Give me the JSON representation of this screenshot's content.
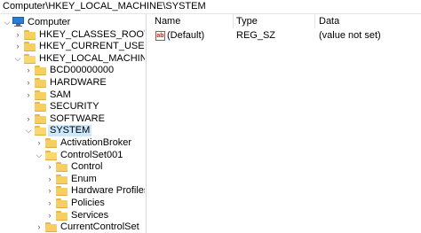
{
  "address": {
    "path": "Computer\\HKEY_LOCAL_MACHINE\\SYSTEM"
  },
  "tree": {
    "items": [
      {
        "label": "Computer",
        "icon": "computer-icon",
        "chevron": "v"
      },
      {
        "label": "HKEY_CLASSES_ROOT",
        "icon": "folder-icon",
        "chevron": ">"
      },
      {
        "label": "HKEY_CURRENT_USER",
        "icon": "folder-icon",
        "chevron": ">"
      },
      {
        "label": "HKEY_LOCAL_MACHINE",
        "icon": "folder-open-icon",
        "chevron": "v"
      },
      {
        "label": "BCD00000000",
        "icon": "folder-icon",
        "chevron": ">"
      },
      {
        "label": "HARDWARE",
        "icon": "folder-icon",
        "chevron": ">"
      },
      {
        "label": "SAM",
        "icon": "folder-icon",
        "chevron": ">"
      },
      {
        "label": "SECURITY",
        "icon": "folder-icon",
        "chevron": ""
      },
      {
        "label": "SOFTWARE",
        "icon": "folder-icon",
        "chevron": ">"
      },
      {
        "label": "SYSTEM",
        "icon": "folder-open-icon",
        "chevron": "v",
        "selected": true
      },
      {
        "label": "ActivationBroker",
        "icon": "folder-icon",
        "chevron": ">"
      },
      {
        "label": "ControlSet001",
        "icon": "folder-open-icon",
        "chevron": "v"
      },
      {
        "label": "Control",
        "icon": "folder-icon",
        "chevron": ">"
      },
      {
        "label": "Enum",
        "icon": "folder-icon",
        "chevron": ">"
      },
      {
        "label": "Hardware Profiles",
        "icon": "folder-icon",
        "chevron": ">"
      },
      {
        "label": "Policies",
        "icon": "folder-icon",
        "chevron": ">"
      },
      {
        "label": "Services",
        "icon": "folder-icon",
        "chevron": ">"
      },
      {
        "label": "CurrentControlSet",
        "icon": "folder-icon",
        "chevron": ">"
      }
    ]
  },
  "list": {
    "columns": {
      "name": "Name",
      "type": "Type",
      "data": "Data"
    },
    "rows": [
      {
        "name": "(Default)",
        "type": "REG_SZ",
        "data": "(value not set)",
        "icon": "string-value-icon"
      }
    ]
  }
}
